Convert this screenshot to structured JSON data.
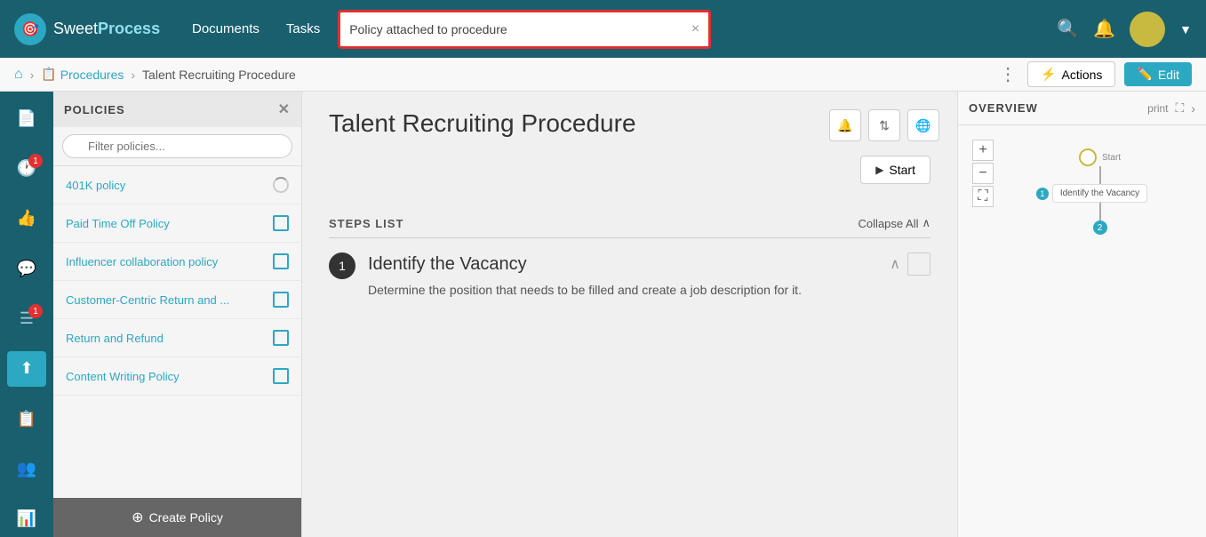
{
  "topnav": {
    "logo_sweet": "Sweet",
    "logo_process": "Process",
    "nav_documents": "Documents",
    "nav_tasks": "Tasks",
    "search_text": "Policy attached to procedure",
    "search_close": "×"
  },
  "breadcrumb": {
    "home_icon": "⌂",
    "procedures_label": "Procedures",
    "current": "Talent Recruiting Procedure",
    "actions_label": "Actions",
    "edit_label": "Edit"
  },
  "policies_panel": {
    "title": "POLICIES",
    "filter_placeholder": "Filter policies...",
    "items": [
      {
        "name": "401K policy",
        "type": "spinner"
      },
      {
        "name": "Paid Time Off Policy",
        "type": "checkbox"
      },
      {
        "name": "Influencer collaboration policy",
        "type": "checkbox"
      },
      {
        "name": "Customer-Centric Return and ...",
        "type": "checkbox"
      },
      {
        "name": "Return and Refund",
        "type": "checkbox"
      },
      {
        "name": "Content Writing Policy",
        "type": "checkbox"
      }
    ],
    "create_label": "Create Policy"
  },
  "main": {
    "procedure_title": "Talent Recruiting Procedure",
    "start_label": "Start",
    "steps_label": "STEPS LIST",
    "collapse_all": "Collapse All",
    "steps": [
      {
        "number": "1",
        "title": "Identify the Vacancy",
        "description": "Determine the position that needs to be filled and create a job description for it."
      }
    ]
  },
  "overview": {
    "title": "OVERVIEW",
    "print_label": "print",
    "flow_start": "Start",
    "flow_node1": "Identify the Vacancy",
    "flow_node1_num": "1",
    "flow_node2_num": "2"
  }
}
